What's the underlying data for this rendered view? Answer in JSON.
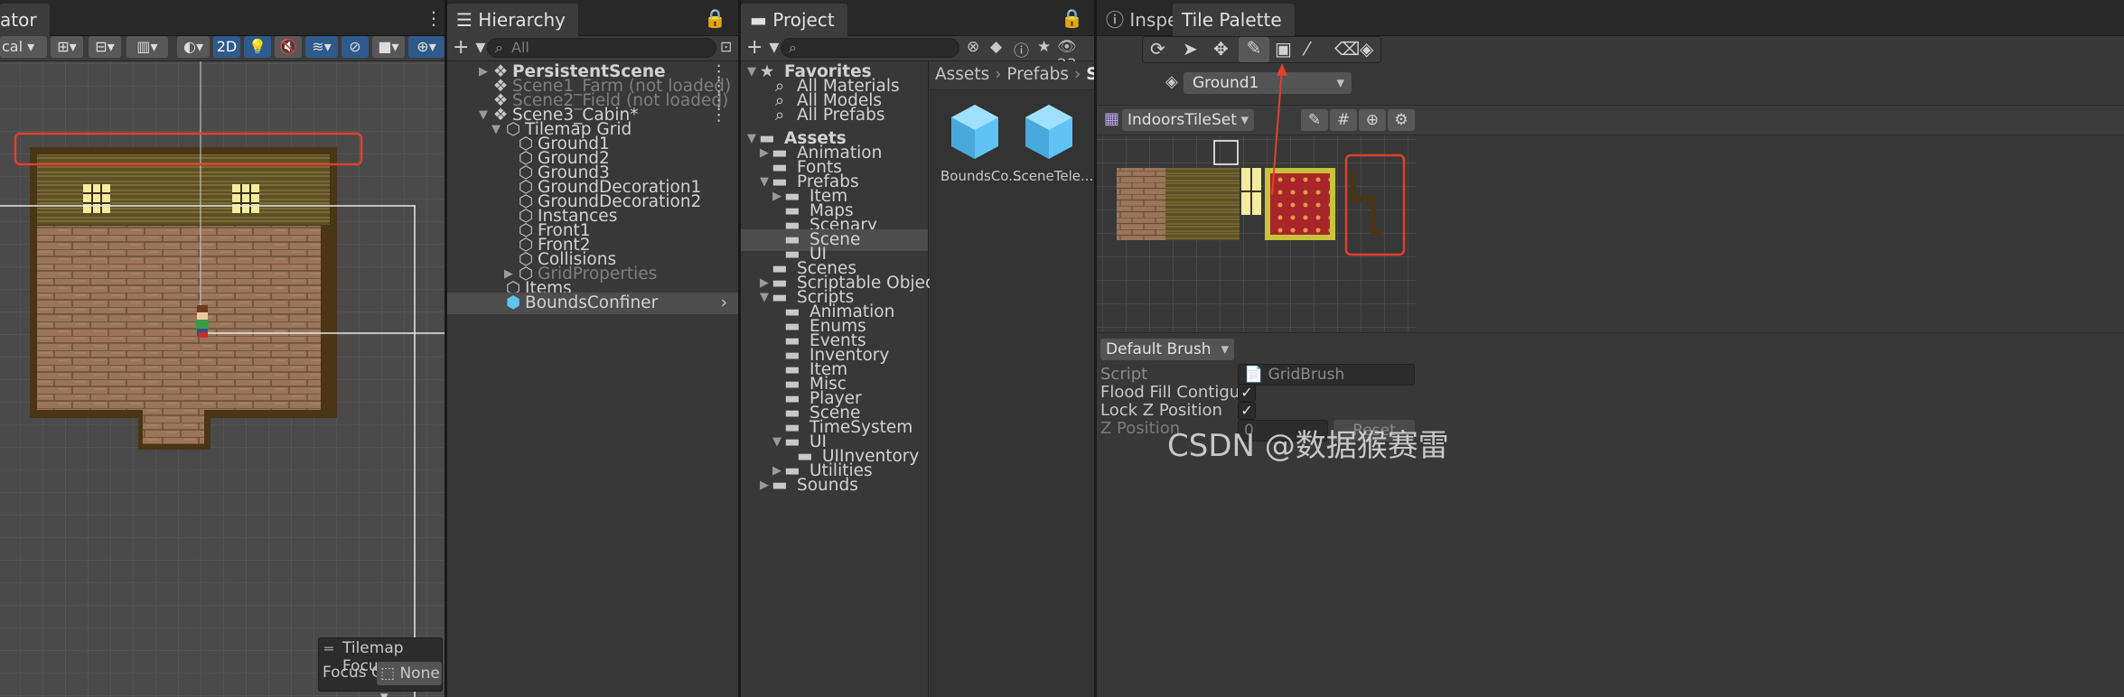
{
  "scene_view": {
    "tab_title": "ator",
    "pivot_label": "cal",
    "mode_2d": "2D",
    "focus_overlay": {
      "title": "Tilemap Focus",
      "focus_on_label": "Focus On",
      "focus_value": "None"
    }
  },
  "hierarchy": {
    "tab_title": "Hierarchy",
    "add_label": "+",
    "search_placeholder": "All",
    "rows": [
      {
        "label": "PersistentScene",
        "icon": "unity-scene-icon"
      },
      {
        "label": "Scene1_Farm (not loaded)",
        "icon": "unity-scene-icon"
      },
      {
        "label": "Scene2_Field (not loaded)",
        "icon": "unity-scene-icon"
      },
      {
        "label": "Scene3_Cabin*",
        "icon": "unity-scene-icon"
      },
      {
        "label": "Tilemap Grid",
        "icon": "gameobject-icon"
      },
      {
        "label": "Ground1",
        "icon": "gameobject-icon"
      },
      {
        "label": "Ground2",
        "icon": "gameobject-icon"
      },
      {
        "label": "Ground3",
        "icon": "gameobject-icon"
      },
      {
        "label": "GroundDecoration1",
        "icon": "gameobject-icon"
      },
      {
        "label": "GroundDecoration2",
        "icon": "gameobject-icon"
      },
      {
        "label": "Instances",
        "icon": "gameobject-icon"
      },
      {
        "label": "Front1",
        "icon": "gameobject-icon"
      },
      {
        "label": "Front2",
        "icon": "gameobject-icon"
      },
      {
        "label": "Collisions",
        "icon": "gameobject-icon"
      },
      {
        "label": "GridProperties",
        "icon": "gameobject-icon"
      },
      {
        "label": "Items",
        "icon": "gameobject-icon"
      },
      {
        "label": "BoundsConfiner",
        "icon": "prefab-icon"
      }
    ]
  },
  "project": {
    "tab_title": "Project",
    "add_label": "+",
    "hidden_count": "23",
    "breadcrumb": [
      "Assets",
      "Prefabs",
      "Scene"
    ],
    "tree": [
      {
        "label": "Favorites",
        "icon": "star-icon"
      },
      {
        "label": "All Materials",
        "icon": "search-icon"
      },
      {
        "label": "All Models",
        "icon": "search-icon"
      },
      {
        "label": "All Prefabs",
        "icon": "search-icon"
      },
      {
        "label": "Assets",
        "icon": "folder-icon"
      },
      {
        "label": "Animation",
        "icon": "folder-icon"
      },
      {
        "label": "Fonts",
        "icon": "folder-icon"
      },
      {
        "label": "Prefabs",
        "icon": "folder-icon"
      },
      {
        "label": "Item",
        "icon": "folder-icon"
      },
      {
        "label": "Maps",
        "icon": "folder-icon"
      },
      {
        "label": "Scenary",
        "icon": "folder-icon"
      },
      {
        "label": "Scene",
        "icon": "folder-icon"
      },
      {
        "label": "UI",
        "icon": "folder-icon"
      },
      {
        "label": "Scenes",
        "icon": "folder-icon"
      },
      {
        "label": "Scriptable Object Assets",
        "icon": "folder-icon"
      },
      {
        "label": "Scripts",
        "icon": "folder-icon"
      },
      {
        "label": "Animation",
        "icon": "folder-icon"
      },
      {
        "label": "Enums",
        "icon": "folder-icon"
      },
      {
        "label": "Events",
        "icon": "folder-icon"
      },
      {
        "label": "Inventory",
        "icon": "folder-icon"
      },
      {
        "label": "Item",
        "icon": "folder-icon"
      },
      {
        "label": "Misc",
        "icon": "folder-icon"
      },
      {
        "label": "Player",
        "icon": "folder-icon"
      },
      {
        "label": "Scene",
        "icon": "folder-icon"
      },
      {
        "label": "TimeSystem",
        "icon": "folder-icon"
      },
      {
        "label": "UI",
        "icon": "folder-icon"
      },
      {
        "label": "UIInventory",
        "icon": "folder-icon"
      },
      {
        "label": "Utilities",
        "icon": "folder-icon"
      },
      {
        "label": "Sounds",
        "icon": "folder-icon"
      }
    ],
    "assets": [
      {
        "label": "BoundsCo..."
      },
      {
        "label": "SceneTele..."
      }
    ]
  },
  "tile_palette": {
    "tab_inspector": "Inspector",
    "tab_palette": "Tile Palette",
    "active_tilemap": "Ground1",
    "palette_name": "IndoorsTileSet",
    "brush": "Default Brush",
    "script_label": "Script",
    "script_value": "GridBrush",
    "flood_fill_label": "Flood Fill Contiguous Only",
    "flood_fill_checked": true,
    "lock_z_label": "Lock Z Position",
    "lock_z_checked": true,
    "z_position_label": "Z Position",
    "z_position_value": "0",
    "reset_label": "Reset"
  },
  "watermark": "CSDN @数据猴赛雷",
  "colors": {
    "annotation_red": "#e0402f",
    "selection_blue": "#3a72b0",
    "prefab_blue": "#5fc3f5"
  }
}
